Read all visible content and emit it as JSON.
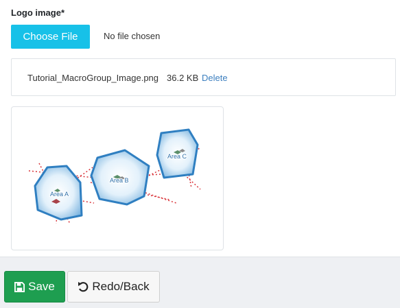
{
  "upload": {
    "label": "Logo image*",
    "choose_button": "Choose File",
    "no_file_text": "No file chosen"
  },
  "file": {
    "name": "Tutorial_MacroGroup_Image.png",
    "size": "36.2 KB",
    "delete_label": "Delete"
  },
  "preview": {
    "areas": [
      {
        "label": "Area A"
      },
      {
        "label": "Area B"
      },
      {
        "label": "Area C"
      }
    ]
  },
  "actions": {
    "save_label": "Save",
    "redo_label": "Redo/Back"
  },
  "colors": {
    "choose_button": "#17c1e8",
    "save_button": "#1e9e50",
    "delete_link": "#3c7fbf",
    "area_fill": "#d6ecfa",
    "area_stroke": "#2f7fc1",
    "dotted_lines": "#d9343a"
  },
  "icons": {
    "save": "floppy-disk-icon",
    "redo": "undo-arrow-icon"
  }
}
